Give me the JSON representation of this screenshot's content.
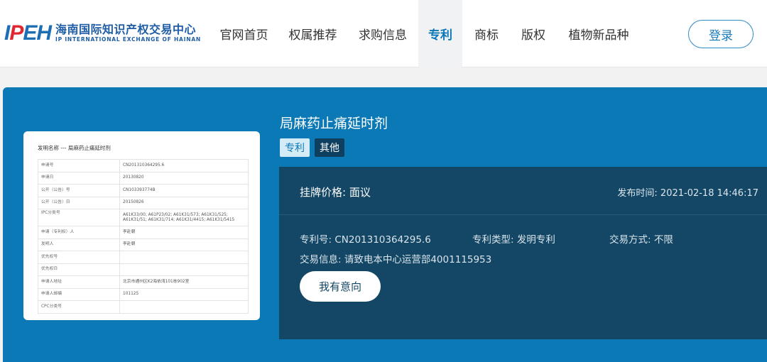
{
  "logo": {
    "mark_i": "I",
    "mark_p": "P",
    "mark_eh": "EH",
    "cn": "海南国际知识产权交易中心",
    "en": "IP INTERNATIONAL EXCHANGE OF HAINAN"
  },
  "nav": {
    "items": [
      {
        "label": "官网首页"
      },
      {
        "label": "权属推荐"
      },
      {
        "label": "求购信息"
      },
      {
        "label": "专利"
      },
      {
        "label": "商标"
      },
      {
        "label": "版权"
      },
      {
        "label": "植物新品种"
      }
    ],
    "login": "登录"
  },
  "product": {
    "title": "局麻药止痛延时剂",
    "tags": [
      "专利",
      "其他"
    ],
    "price": "挂牌价格:  面议",
    "publish_time": "发布时间: 2021-02-18 14:46:17",
    "patent_no": "专利号: CN201310364295.6",
    "patent_type": "专利类型:  发明专利",
    "trade_mode": "交易方式:  不限",
    "trade_info": "交易信息:  请致电本中心运营部4001115953",
    "interest_button": "我有意向"
  },
  "document": {
    "title": "发明名称 --- 局麻药止痛延时剂",
    "rows": [
      {
        "k": "申请号",
        "v": "CN201310364295.6"
      },
      {
        "k": "申请日",
        "v": "20130820"
      },
      {
        "k": "公开（公告）号",
        "v": "CN103393774B"
      },
      {
        "k": "公开（公告）日",
        "v": "20150826"
      },
      {
        "k": "IPC分类号",
        "v": "A61K33/00; A61P23/02; A61K31/573; A61K31/525; A61K31/51; A61K31/714; A61K31/4415; A61K31/5415"
      },
      {
        "k": "申请（专利权）人",
        "v": "李赴朝"
      },
      {
        "k": "发明人",
        "v": "李赴朝"
      },
      {
        "k": "优先权号",
        "v": ""
      },
      {
        "k": "优先权日",
        "v": ""
      },
      {
        "k": "申请人地址",
        "v": "北京市通州区K2海依湾101栋902室"
      },
      {
        "k": "申请人邮编",
        "v": "101125"
      },
      {
        "k": "CPC分类号",
        "v": ""
      }
    ]
  },
  "colors": {
    "accent": "#0b79b6",
    "panel_dark": "#134765",
    "tag_dark": "#0e3f5e",
    "nav_active": "#0d76b6"
  }
}
